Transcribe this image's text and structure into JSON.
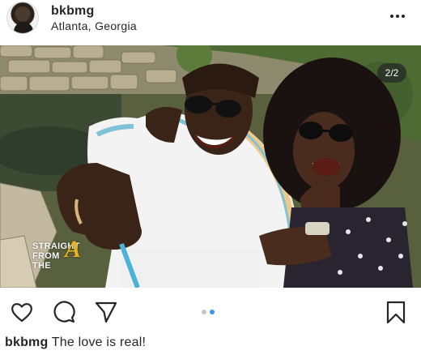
{
  "post": {
    "username": "bkbmg",
    "location": "Atlanta, Georgia",
    "more_icon": "more-horizontal-icon",
    "image_counter": "2/2",
    "watermark": {
      "line1": "STRAIGHT",
      "line2": "FROM",
      "line3": "THE",
      "mark": "A"
    },
    "carousel": {
      "count": 2,
      "active": 2
    },
    "actions": {
      "like_icon": "heart-icon",
      "comment_icon": "comment-icon",
      "share_icon": "paper-plane-icon",
      "save_icon": "bookmark-icon"
    },
    "caption": {
      "username": "bkbmg",
      "text": " The love is real!"
    },
    "colors": {
      "accent_dot": "#3897f0",
      "text": "#262626"
    }
  }
}
